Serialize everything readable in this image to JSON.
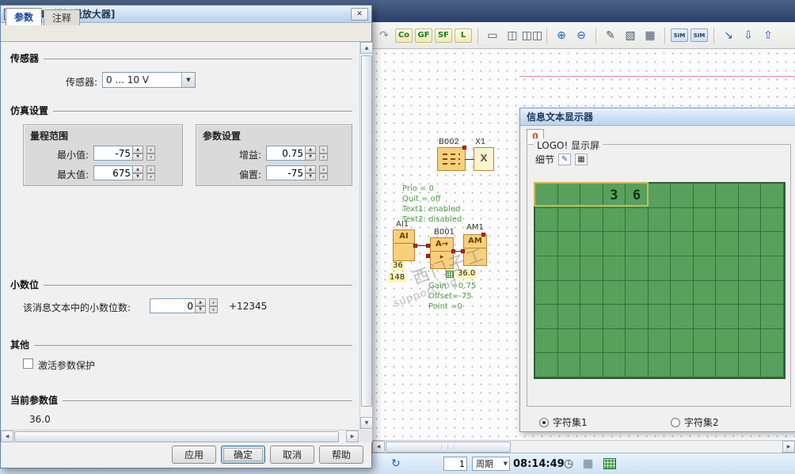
{
  "icons": {
    "close": "✕",
    "up": "▲",
    "down": "▼",
    "left": "◀",
    "right": "▶",
    "edit": "✎",
    "charset_grid": "▦",
    "refresh": "↻",
    "clock": "◷",
    "grid": "▦",
    "grip": "⋮⋮⋮"
  },
  "dialog": {
    "title": "B001 [模拟量放大器]",
    "tabs": [
      {
        "label": "参数",
        "active": true
      },
      {
        "label": "注释",
        "active": false
      }
    ],
    "sensor": {
      "heading": "传感器",
      "label": "传感器:",
      "value": "0 ... 10 V"
    },
    "sim_heading": "仿真设置",
    "range": {
      "title": "量程范围",
      "rows": [
        {
          "label": "最小值:",
          "value": "-75"
        },
        {
          "label": "最大值:",
          "value": "675"
        }
      ]
    },
    "params": {
      "title": "参数设置",
      "rows": [
        {
          "label": "增益:",
          "value": "0.75"
        },
        {
          "label": "偏置:",
          "value": "-75"
        }
      ]
    },
    "decimal": {
      "heading": "小数位",
      "label": "该消息文本中的小数位数:",
      "value": "0",
      "sample": "+12345"
    },
    "other": {
      "heading": "其他",
      "checkbox_label": "激活参数保护",
      "checked": false
    },
    "current": {
      "heading": "当前参数值",
      "value": "36.0"
    },
    "buttons": [
      {
        "label": "应用"
      },
      {
        "label": "确定"
      },
      {
        "label": "取消"
      },
      {
        "label": "帮助"
      }
    ]
  },
  "toolbar": {
    "items": [
      {
        "name": "redo-icon",
        "glyph": "↷",
        "color": "#8a8f98"
      },
      {
        "name": "connectors-button",
        "label": "Co"
      },
      {
        "name": "basic-functions-button",
        "label": "GF"
      },
      {
        "name": "special-functions-button",
        "label": "SF"
      },
      {
        "name": "line-button",
        "label": "L"
      },
      {
        "name": "sep"
      },
      {
        "name": "window-single-icon",
        "glyph": "▭",
        "color": "#4a5668"
      },
      {
        "name": "window-split-2-icon",
        "glyph": "◫",
        "color": "#4a5668"
      },
      {
        "name": "window-split-3-icon",
        "glyph": "◫◫",
        "color": "#4a5668"
      },
      {
        "name": "sep"
      },
      {
        "name": "zoom-in-icon",
        "glyph": "⊕",
        "color": "#1f5fbf"
      },
      {
        "name": "zoom-out-icon",
        "glyph": "⊖",
        "color": "#1f5fbf"
      },
      {
        "name": "sep"
      },
      {
        "name": "pencil-icon",
        "glyph": "✎",
        "color": "#555555"
      },
      {
        "name": "selection-grid-icon",
        "glyph": "▧",
        "color": "#4a5668"
      },
      {
        "name": "hatch-grid-icon",
        "glyph": "▦",
        "color": "#4a5668"
      },
      {
        "name": "sep"
      },
      {
        "name": "simulation-icon",
        "sim": "SIM"
      },
      {
        "name": "online-test-icon",
        "sim": "SIM"
      },
      {
        "name": "sep"
      },
      {
        "name": "fit-selection-icon",
        "glyph": "↘",
        "color": "#1f5fbf"
      },
      {
        "name": "download-icon",
        "glyph": "⇩",
        "color": "#1f5fbf"
      },
      {
        "name": "upload-icon",
        "glyph": "⇧",
        "color": "#1f5fbf"
      }
    ]
  },
  "canvas": {
    "b002_label": "B002",
    "x1_label": "X1",
    "x1_symbol": "X",
    "notes_top": [
      "Prio = 0",
      "Quit = off",
      "Text1: enabled",
      "Text2: disabled"
    ],
    "ai1_label": "AI1",
    "ai_symbol": "AI",
    "b001_label": "B001",
    "b001_symbol": "A→",
    "am1_label": "AM1",
    "am_symbol": "AM",
    "ai_values": [
      "36",
      "148"
    ],
    "am_value": "36.0",
    "notes_bottom": [
      "Gain: =0.75",
      "Offset=-75",
      "Point =0"
    ]
  },
  "message_window": {
    "title": "信息文本显示器",
    "tab_label": "0",
    "group_title": "LOGO! 显示屏",
    "detail_label": "细节",
    "display": {
      "cols": 11,
      "rows": 8,
      "lcd_color": "#58a15c",
      "grid_color": "#2c5e33",
      "highlight": {
        "row": 0,
        "col_start": 0,
        "col_end": 4
      },
      "chars": [
        {
          "row": 0,
          "col": 3,
          "ch": "3"
        },
        {
          "row": 0,
          "col": 4,
          "ch": "6"
        }
      ]
    },
    "radios": [
      {
        "label": "字符集1",
        "selected": true
      },
      {
        "label": "字符集2",
        "selected": false
      }
    ]
  },
  "statusbar": {
    "counter": "1",
    "cycle_label": "周期",
    "time": "08:14:49"
  },
  "watermark": {
    "line1": "西门子工",
    "line2": "support.ind"
  }
}
